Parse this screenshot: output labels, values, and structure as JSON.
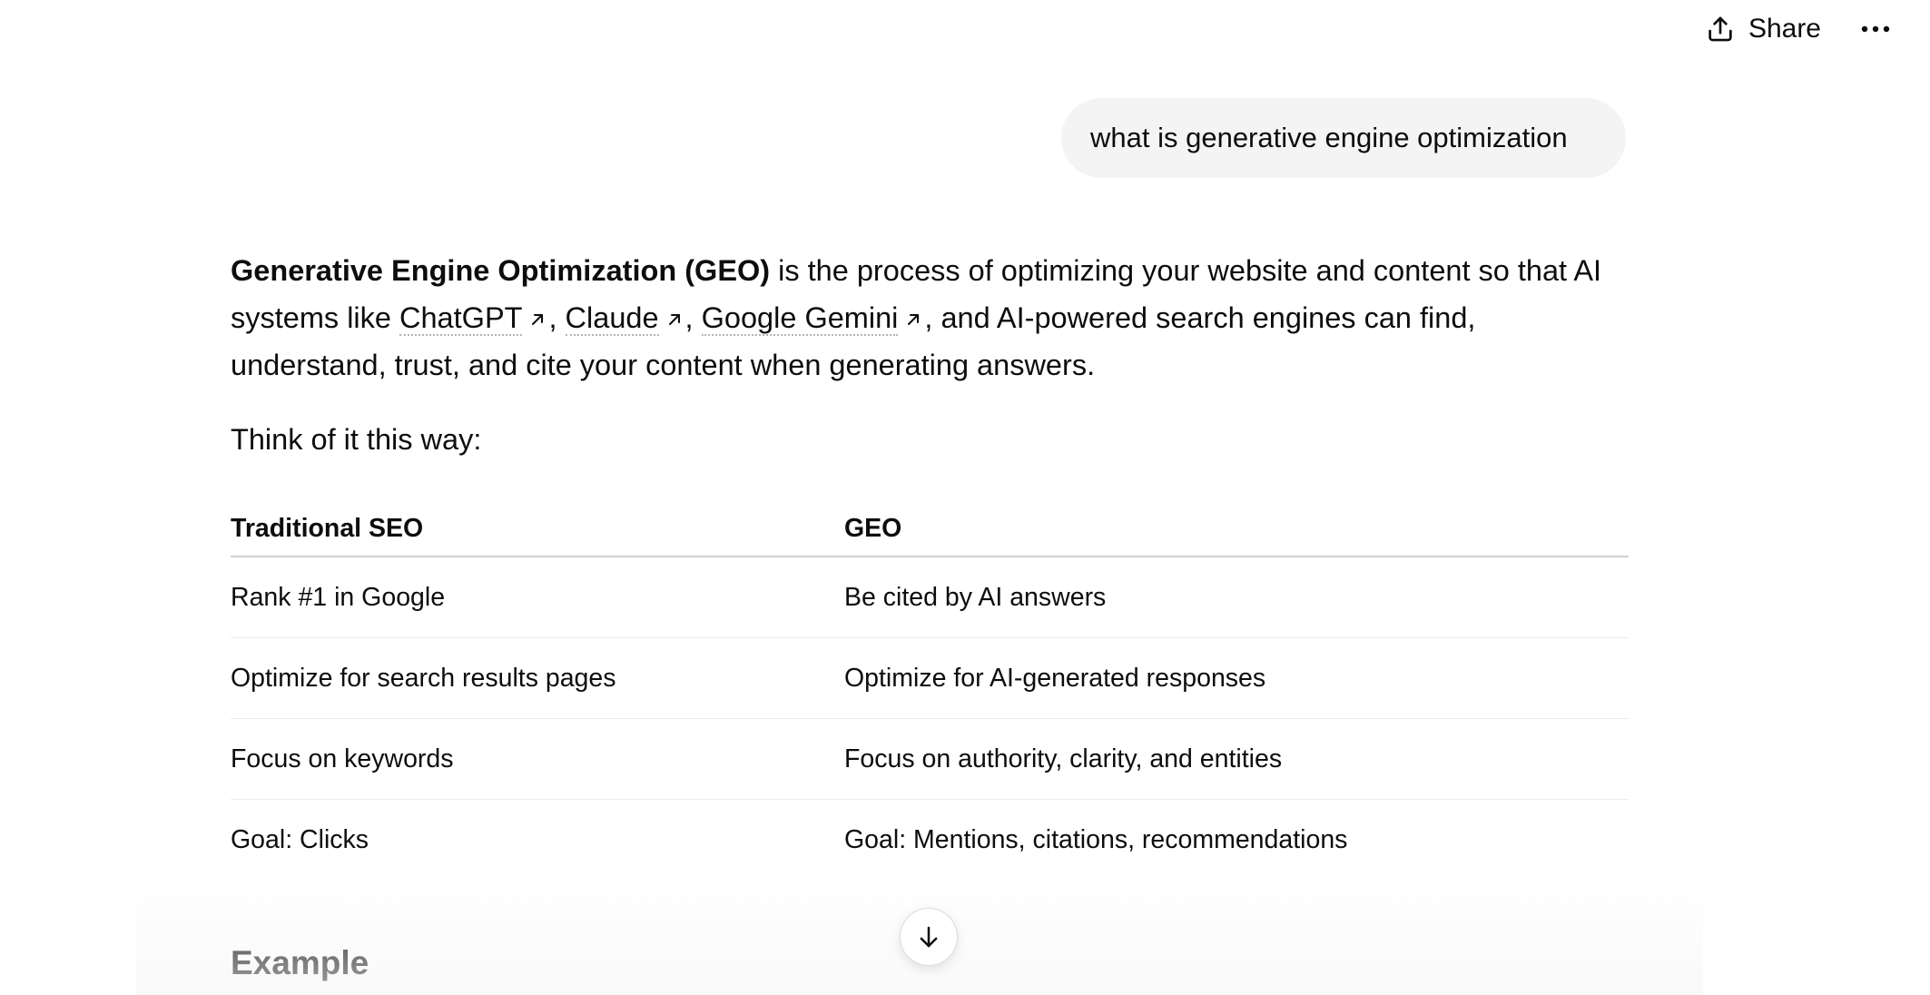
{
  "header": {
    "share_label": "Share",
    "share_icon": "share-upload-icon",
    "more_icon": "more-horizontal-icon"
  },
  "user_message": {
    "text": "what is generative engine optimization"
  },
  "response": {
    "intro": {
      "bold": "Generative Engine Optimization (GEO)",
      "text1": " is the process of optimizing your website and content so that AI systems like ",
      "link1": "ChatGPT",
      "sep1": ", ",
      "link2": "Claude",
      "sep2": ", ",
      "link3": "Google Gemini",
      "text2": ", and AI-powered search engines can find, understand, trust, and cite your content when generating answers."
    },
    "think_line": "Think of it this way:",
    "table": {
      "headers": [
        "Traditional SEO",
        "GEO"
      ],
      "rows": [
        [
          "Rank #1 in Google",
          "Be cited by AI answers"
        ],
        [
          "Optimize for search results pages",
          "Optimize for AI-generated responses"
        ],
        [
          "Focus on keywords",
          "Focus on authority, clarity, and entities"
        ],
        [
          "Goal: Clicks",
          "Goal: Mentions, citations, recommendations"
        ]
      ]
    },
    "example_heading": "Example"
  },
  "scroll_button": {
    "icon": "arrow-down-icon"
  },
  "colors": {
    "background": "#ffffff",
    "bubble": "#f4f4f4",
    "text": "#0d0d0d",
    "divider": "#d0d0d0"
  }
}
